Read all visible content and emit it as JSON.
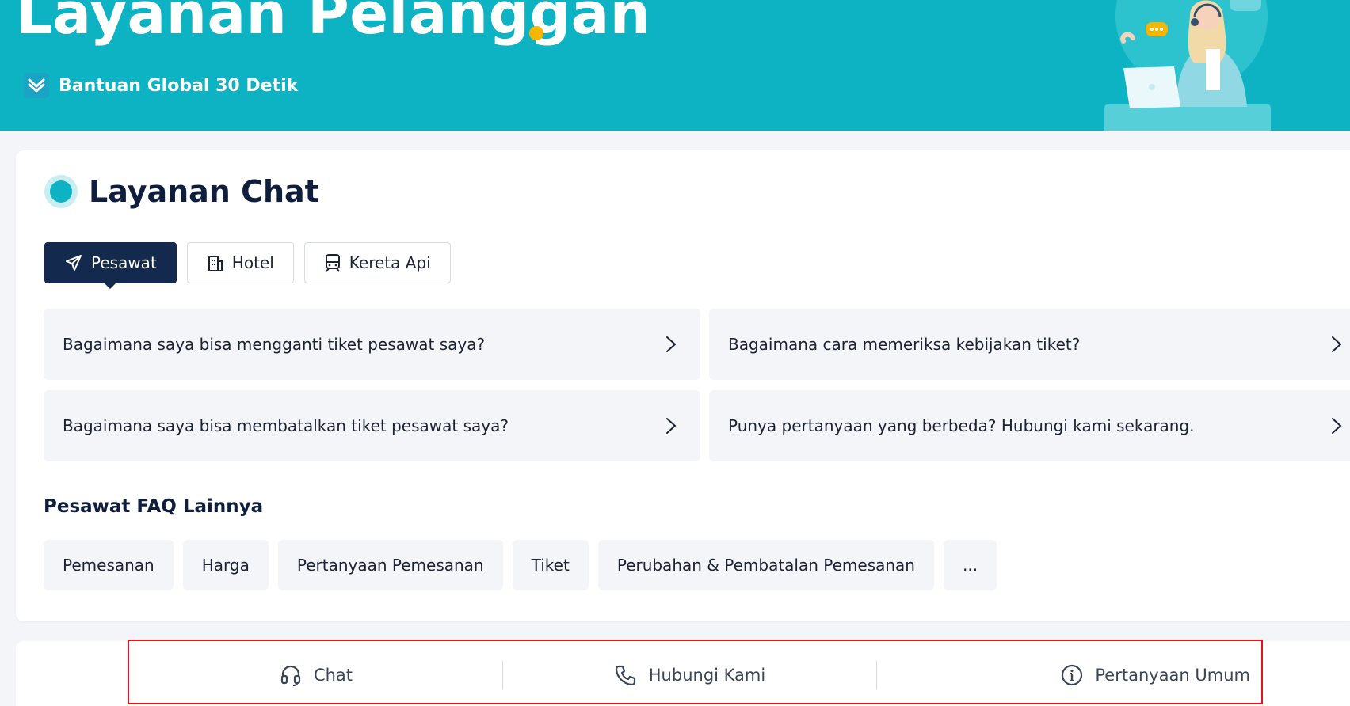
{
  "hero": {
    "title": "Layanan Pelanggan",
    "badge_text": "Bantuan Global 30 Detik",
    "colors": {
      "background": "#0db3c2",
      "dot": "#f6b500"
    }
  },
  "chat_section": {
    "title": "Layanan Chat",
    "tabs": [
      {
        "label": "Pesawat",
        "icon": "plane-icon",
        "active": true
      },
      {
        "label": "Hotel",
        "icon": "building-icon",
        "active": false
      },
      {
        "label": "Kereta Api",
        "icon": "train-icon",
        "active": false
      }
    ],
    "faqs": [
      "Bagaimana saya bisa mengganti tiket pesawat saya?",
      "Bagaimana cara memeriksa kebijakan tiket?",
      "Bagaimana saya bisa membatalkan tiket pesawat saya?",
      "Punya pertanyaan yang berbeda? Hubungi kami sekarang."
    ],
    "more_title": "Pesawat FAQ Lainnya",
    "chips": [
      "Pemesanan",
      "Harga",
      "Pertanyaan Pemesanan",
      "Tiket",
      "Perubahan & Pembatalan Pemesanan",
      "..."
    ]
  },
  "bottom_nav": {
    "items": [
      {
        "label": "Chat",
        "icon": "headset-icon"
      },
      {
        "label": "Hubungi Kami",
        "icon": "phone-icon"
      },
      {
        "label": "Pertanyaan Umum",
        "icon": "info-icon"
      }
    ]
  }
}
